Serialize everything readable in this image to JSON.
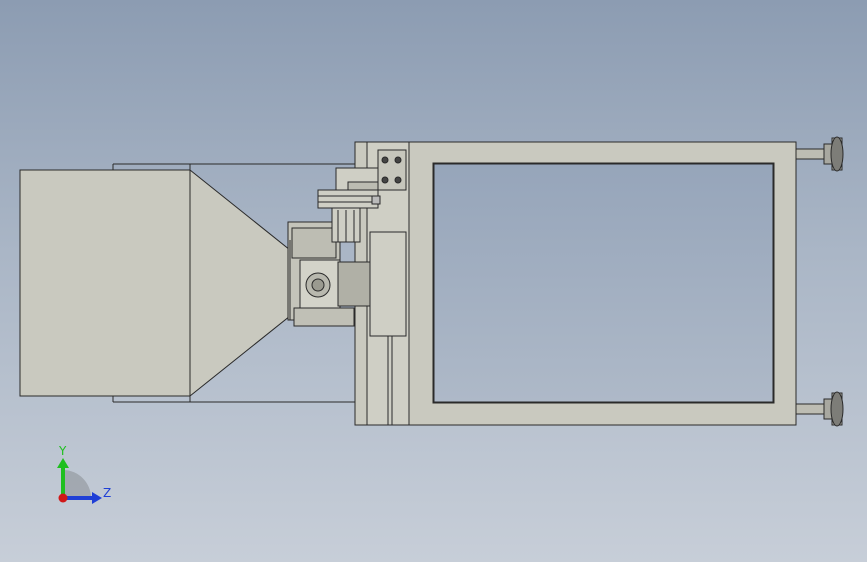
{
  "viewport": {
    "background_top": "#8c9cb2",
    "background_bottom": "#c7ced8"
  },
  "model": {
    "part_fill": "#c9c9bf",
    "edge_color": "#2a2a2a"
  },
  "triad": {
    "y_label": "Y",
    "z_label": "Z",
    "y_axis_color": "#1fbf1f",
    "z_axis_color": "#1f3fd6",
    "x_axis_color": "#d01818"
  }
}
